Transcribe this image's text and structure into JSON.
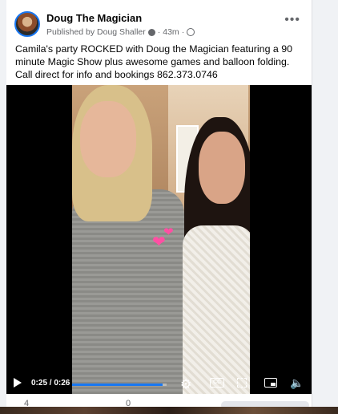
{
  "post": {
    "author": "Doug The Magician",
    "published_by": "Published by Doug Shaller",
    "time_ago": "43m",
    "more_label": "•••",
    "caption": "Camila's party ROCKED with Doug the Magician featuring a 90 minute Magic Show plus awesome games and balloon folding. Call direct for info and bookings 862.373.0746"
  },
  "video": {
    "time_display": "0:25 / 0:26",
    "progress": 0.96,
    "cc_label": "CC",
    "accent_color": "#1877f2",
    "icons": [
      "play-icon",
      "settings-icon",
      "captions-icon",
      "fullscreen-icon",
      "picture-in-picture-icon",
      "volume-icon"
    ],
    "overlay_sticker": "hearts"
  },
  "footer": {
    "reactions_count": "4",
    "comments_count": "0"
  }
}
